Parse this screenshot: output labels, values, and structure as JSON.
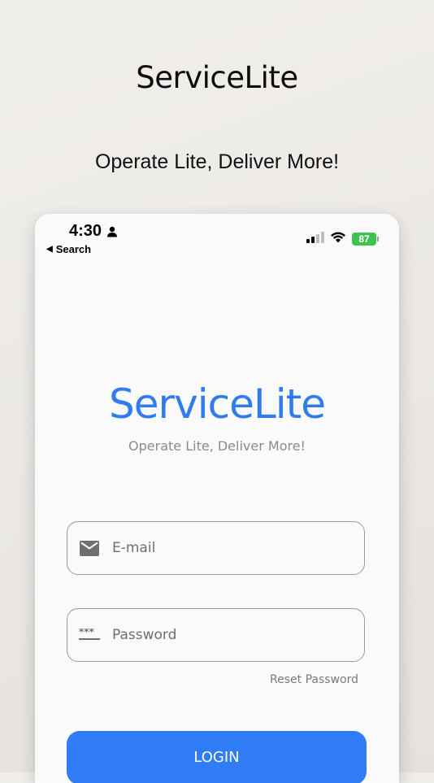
{
  "promo": {
    "title": "ServiceLite",
    "tagline": "Operate Lite, Deliver More!"
  },
  "status_bar": {
    "time": "4:30",
    "back_label": "Search",
    "battery_level": "87"
  },
  "app": {
    "logo_text": "ServiceLite",
    "tagline": "Operate Lite, Deliver More!"
  },
  "form": {
    "email_placeholder": "E-mail",
    "email_value": "",
    "password_placeholder": "Password",
    "password_value": "",
    "reset_label": "Reset Password",
    "login_label": "LOGIN"
  },
  "colors": {
    "brand": "#2f7bf0",
    "button": "#2f7cf6",
    "battery": "#3fc24f"
  },
  "icons": {
    "person": "person-icon",
    "back": "back-triangle-icon",
    "signal": "cellular-signal-icon",
    "wifi": "wifi-icon",
    "battery": "battery-icon",
    "email": "mail-icon",
    "password": "password-dots-icon"
  }
}
